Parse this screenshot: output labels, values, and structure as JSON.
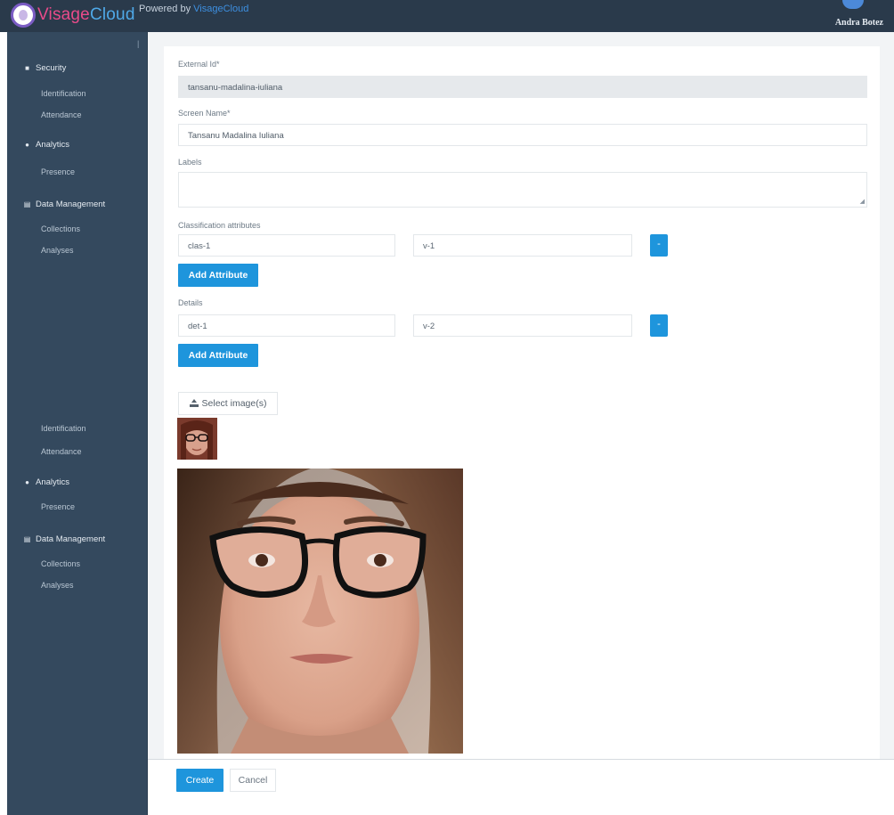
{
  "app": {
    "logo_visage": "Visage",
    "logo_cloud": "Cloud",
    "powered_by_prefix": "Powered by ",
    "powered_by_brand": "VisageCloud",
    "user_name": "Andra Botez"
  },
  "sidebar": {
    "top": [
      {
        "group": "Security",
        "icon": "camera-icon",
        "items": [
          "Identification",
          "Attendance"
        ]
      },
      {
        "group": "Analytics",
        "icon": "pie-chart-icon",
        "items": [
          "Presence"
        ]
      },
      {
        "group": "Data Management",
        "icon": "database-icon",
        "items": [
          "Collections",
          "Analyses"
        ]
      }
    ],
    "bottom": [
      {
        "items": [
          "Identification",
          "Attendance"
        ]
      },
      {
        "group": "Analytics",
        "icon": "pie-chart-icon",
        "items": [
          "Presence"
        ]
      },
      {
        "group": "Data Management",
        "icon": "database-icon",
        "items": [
          "Collections",
          "Analyses"
        ]
      }
    ]
  },
  "form": {
    "external_id": {
      "label": "External Id*",
      "value": "tansanu-madalina-iuliana"
    },
    "screen_name": {
      "label": "Screen Name*",
      "value": "Tansanu Madalina Iuliana"
    },
    "labels": {
      "label": "Labels",
      "value": ""
    },
    "classification": {
      "label": "Classification attributes",
      "rows": [
        {
          "key": "clas-1",
          "value": "v-1",
          "remove": "-"
        }
      ],
      "add_label": "Add Attribute"
    },
    "details": {
      "label": "Details",
      "rows": [
        {
          "key": "det-1",
          "value": "v-2",
          "remove": "-"
        }
      ],
      "add_label": "Add Attribute"
    },
    "select_images_label": "Select image(s)"
  },
  "footer": {
    "create_label": "Create",
    "cancel_label": "Cancel"
  },
  "colors": {
    "topbar": "#2a3a4b",
    "sidebar": "#34495e",
    "primary": "#1e95dc",
    "content_bg": "#f2f4f6"
  }
}
